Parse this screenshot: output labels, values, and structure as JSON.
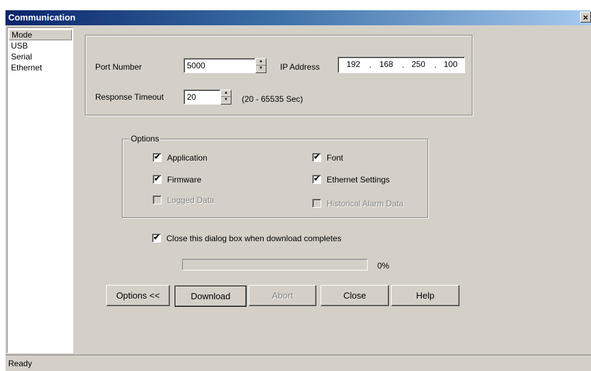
{
  "window": {
    "title": "Communication",
    "close_glyph": "×"
  },
  "sidebar": {
    "items": [
      {
        "label": "Mode"
      },
      {
        "label": "USB"
      },
      {
        "label": "Serial"
      },
      {
        "label": "Ethernet"
      }
    ]
  },
  "connection": {
    "port_label": "Port Number",
    "port_value": "5000",
    "ip_label": "IP Address",
    "ip_parts": [
      "192",
      "168",
      "250",
      "100"
    ],
    "ip_dot": ".",
    "timeout_label": "Response Timeout",
    "timeout_value": "20",
    "timeout_range": "(20 - 65535 Sec)"
  },
  "options": {
    "title": "Options",
    "items": [
      {
        "label": "Application",
        "checked": true,
        "enabled": true
      },
      {
        "label": "Font",
        "checked": true,
        "enabled": true
      },
      {
        "label": "Firmware",
        "checked": true,
        "enabled": true
      },
      {
        "label": "Ethernet Settings",
        "checked": true,
        "enabled": true
      },
      {
        "label": "Logged Data",
        "checked": false,
        "enabled": false
      },
      {
        "label": "Historical Alarm Data",
        "checked": false,
        "enabled": false
      }
    ]
  },
  "close_dialog": {
    "label": "Close this dialog box when download completes",
    "checked": true
  },
  "progress": {
    "value": 0,
    "text": "0%"
  },
  "buttons": {
    "options": "Options <<",
    "download": "Download",
    "abort": "Abort",
    "close": "Close",
    "help": "Help"
  },
  "status": {
    "text": "Ready"
  },
  "check_glyph": "✔"
}
